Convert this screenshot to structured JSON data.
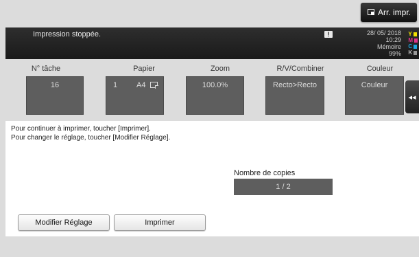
{
  "header": {
    "stop_print_label": "Arr. impr."
  },
  "status": {
    "message": "Impression stoppée.",
    "warning_symbol": "!",
    "date": "28/ 05/ 2018",
    "time": "10:29",
    "memory_label": "Mémoire",
    "memory_value": "99%",
    "toner": [
      {
        "label": "Y",
        "color": "#f2e200"
      },
      {
        "label": "M",
        "color": "#e0338a"
      },
      {
        "label": "C",
        "color": "#1fa7e0"
      },
      {
        "label": "K",
        "color": "#9a9a9a"
      }
    ]
  },
  "settings": {
    "columns": [
      {
        "label": "N° tâche",
        "value": "16"
      },
      {
        "label": "Papier",
        "tray": "1",
        "size": "A4"
      },
      {
        "label": "Zoom",
        "value": "100.0%"
      },
      {
        "label": "R/V/Combiner",
        "value": "Recto>Recto"
      },
      {
        "label": "Couleur",
        "value": "Couleur"
      }
    ],
    "side_tab_glyph": "◂◂"
  },
  "panel": {
    "message_line1": "Pour continuer à imprimer, toucher [Imprimer].",
    "message_line2": "Pour changer le réglage, toucher [Modifier Réglage].",
    "copies_label": "Nombre de copies",
    "copies_value": "1 / 2",
    "modify_button": "Modifier Réglage",
    "print_button": "Imprimer"
  }
}
